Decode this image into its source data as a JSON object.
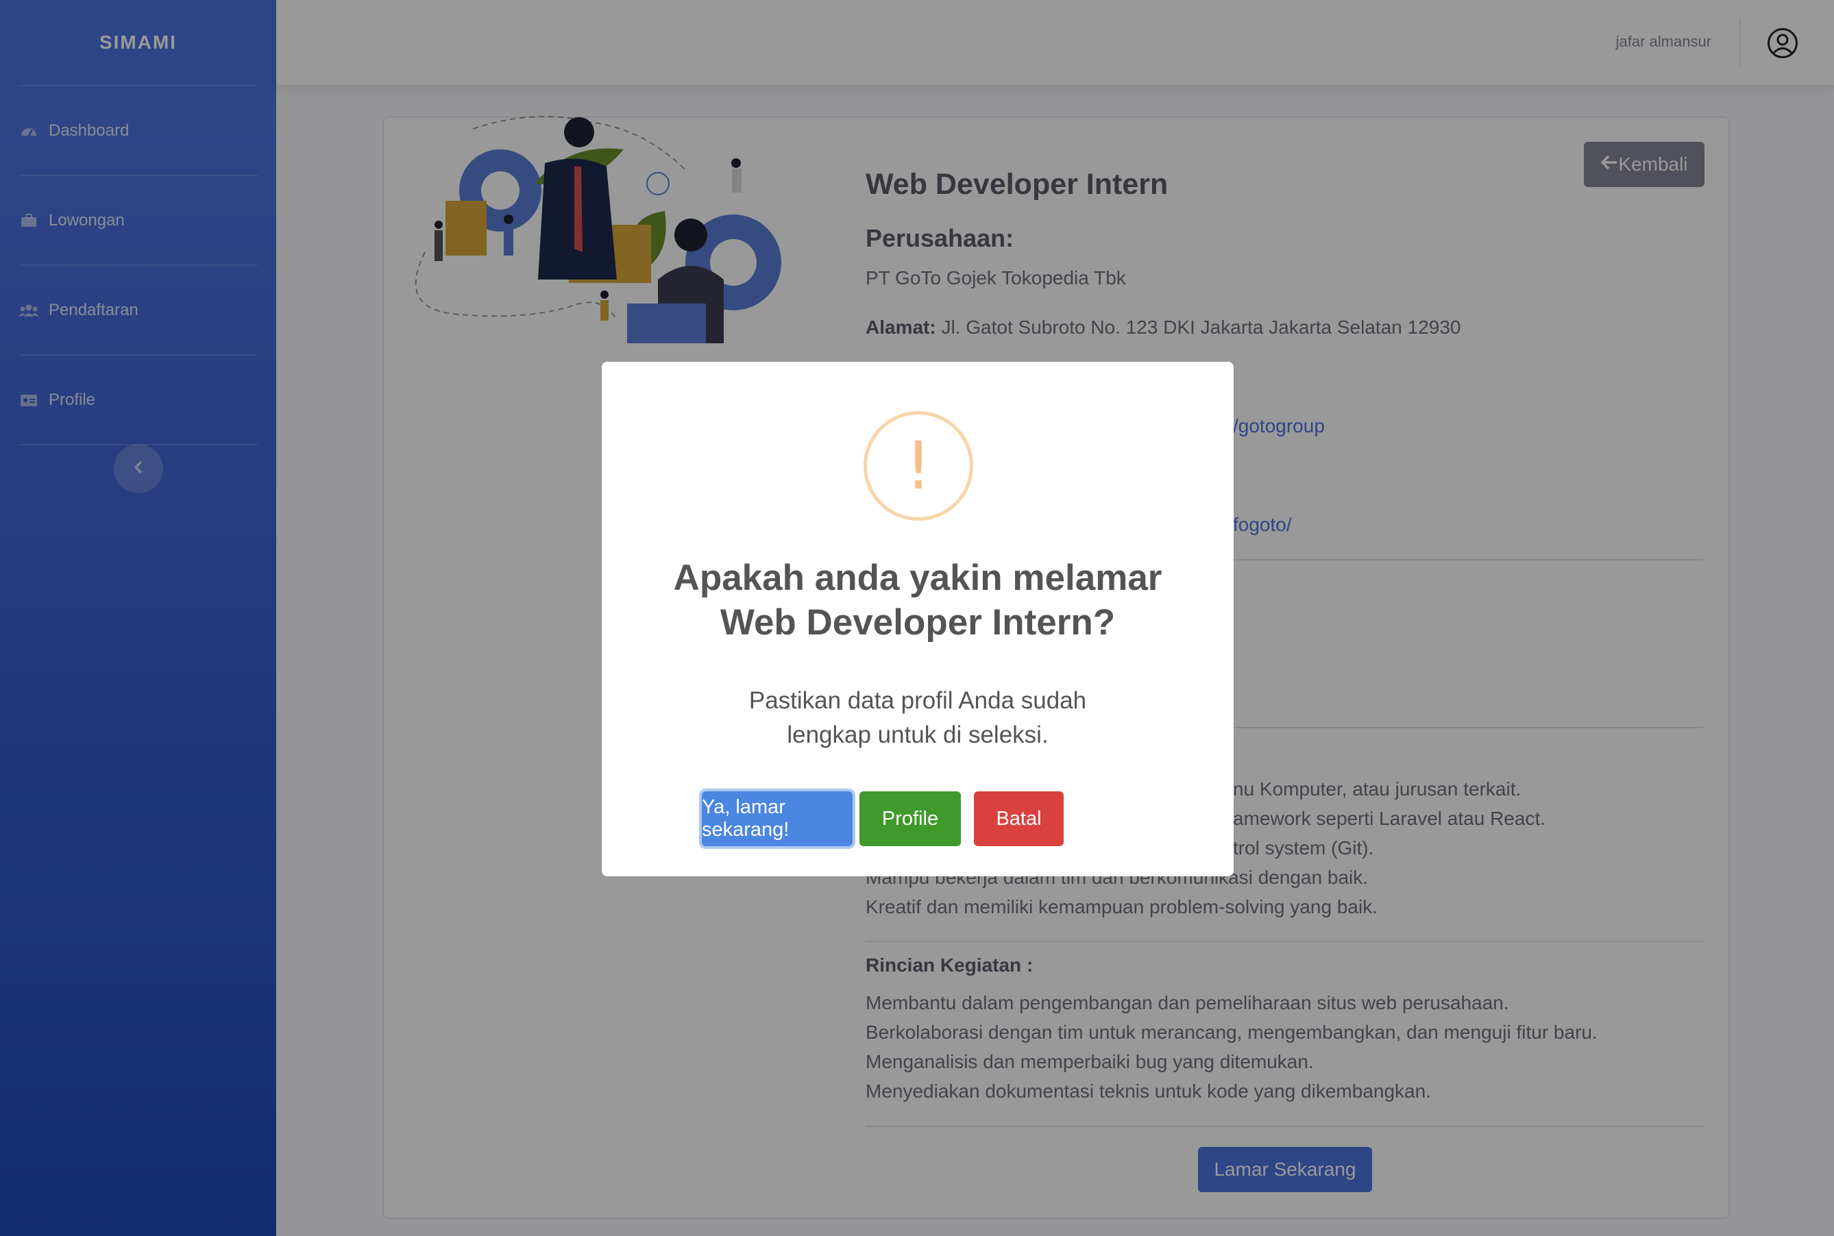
{
  "sidebar": {
    "brand": "SIMAMI",
    "items": [
      {
        "label": "Dashboard",
        "icon": "dashboard-icon"
      },
      {
        "label": "Lowongan",
        "icon": "briefcase-icon"
      },
      {
        "label": "Pendaftaran",
        "icon": "users-icon"
      },
      {
        "label": "Profile",
        "icon": "id-card-icon"
      }
    ],
    "toggle_icon": "chevron-left-icon"
  },
  "topbar": {
    "username": "jafar almansur",
    "avatar_icon": "user-circle-icon"
  },
  "job": {
    "back_label": "Kembali",
    "title": "Web Developer Intern",
    "company_heading": "Perusahaan:",
    "company_name": "PT GoTo Gojek Tokopedia Tbk",
    "address_label": "Alamat:",
    "address_value": "Jl. Gatot Subroto No. 123 DKI Jakarta Jakarta Selatan 12930",
    "link_1_fragment": "/gotogroup",
    "link_2_fragment": "fogoto/",
    "requirements_fragments": [
      "nu Komputer, atau jurusan terkait.",
      "amework seperti Laravel atau React.",
      "trol system (Git).",
      "Mampu bekerja dalam tim dan berkomunikasi dengan baik.",
      "Kreatif dan memiliki kemampuan problem-solving yang baik."
    ],
    "activities_heading": "Rincian Kegiatan :",
    "activities": [
      "Membantu dalam pengembangan dan pemeliharaan situs web perusahaan.",
      "Berkolaborasi dengan tim untuk merancang, mengembangkan, dan menguji fitur baru.",
      "Menganalisis dan memperbaiki bug yang ditemukan.",
      "Menyediakan dokumentasi teknis untuk kode yang dikembangkan."
    ],
    "apply_label": "Lamar Sekarang"
  },
  "modal": {
    "icon": "warning-icon",
    "icon_glyph": "!",
    "title_line1": "Apakah anda yakin melamar",
    "title_line2": "Web Developer Intern?",
    "text_line1": "Pastikan data profil Anda sudah",
    "text_line2": "lengkap untuk di seleksi.",
    "confirm_label": "Ya, lamar sekarang!",
    "profile_label": "Profile",
    "cancel_label": "Batal"
  },
  "colors": {
    "sidebar_top": "#4e73df",
    "sidebar_bottom": "#224abe",
    "primary": "#4e73df",
    "confirm": "#4b86e0",
    "profile": "#3f9a2b",
    "cancel": "#d9413e",
    "warning": "#f8bb86"
  }
}
